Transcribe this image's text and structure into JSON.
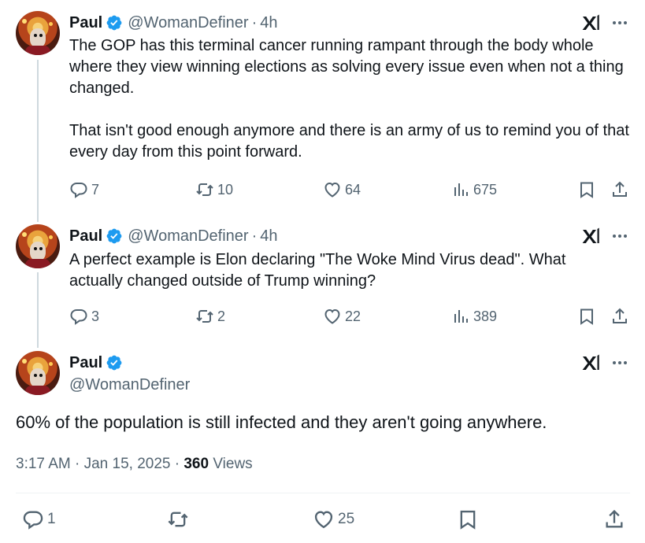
{
  "tweets": [
    {
      "name": "Paul",
      "handle": "@WomanDefiner",
      "sep": "·",
      "time": "4h",
      "text": "The GOP has this terminal cancer running rampant through the body whole where they view winning elections as solving every issue even when not a thing changed.\n\nThat isn't good enough anymore and there is an army of us to remind you of that every day from this point forward.",
      "replies": "7",
      "reposts": "10",
      "likes": "64",
      "views": "675"
    },
    {
      "name": "Paul",
      "handle": "@WomanDefiner",
      "sep": "·",
      "time": "4h",
      "text": "A perfect example is Elon declaring \"The Woke Mind Virus dead\". What actually changed outside of Trump winning?",
      "replies": "3",
      "reposts": "2",
      "likes": "22",
      "views": "389"
    }
  ],
  "main": {
    "name": "Paul",
    "handle": "@WomanDefiner",
    "text": "60% of the population is still infected and they aren't going anywhere.",
    "timestamp": "3:17 AM · Jan 15, 2025 · ",
    "views_count": "360",
    "views_label": " Views",
    "replies": "1",
    "likes": "25"
  },
  "colors": {
    "verified": "#1d9bf0",
    "muted": "#536471",
    "text": "#0f1419"
  },
  "icons": [
    "verified-badge-icon",
    "grok-icon",
    "more-icon",
    "reply-icon",
    "repost-icon",
    "like-icon",
    "views-icon",
    "bookmark-icon",
    "share-icon"
  ]
}
